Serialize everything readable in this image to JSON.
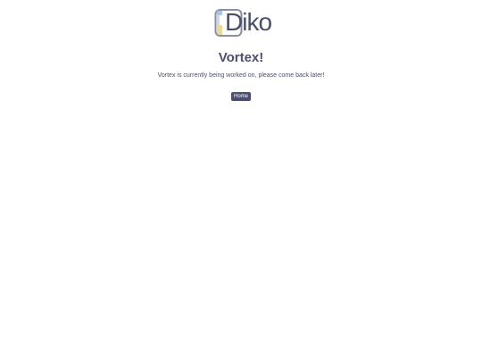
{
  "brand": {
    "logo_text": "Diko",
    "colors": {
      "frame": "#8a8fa3",
      "accent_blue": "#a9c6e8",
      "accent_yellow": "#ecd99c",
      "text": "#4b5069"
    }
  },
  "main": {
    "title": "Vortex!",
    "message": "Vortex is currently being worked on, please come back later!",
    "home_label": "Home",
    "button_color": "#4a4f72"
  }
}
